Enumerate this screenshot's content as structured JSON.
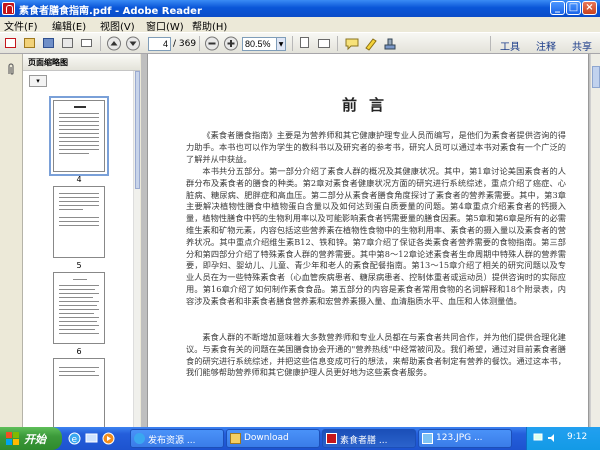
{
  "window": {
    "title": "素食者膳食指南.pdf - Adobe Reader",
    "controls": {
      "minimize": "_",
      "maximize": "□",
      "close": "×"
    }
  },
  "menu": [
    "文件(F)",
    "编辑(E)",
    "视图(V)",
    "窗口(W)",
    "帮助(H)"
  ],
  "toolbar": {
    "page_value": "4",
    "page_total": "/ 369",
    "zoom_value": "80.5%",
    "right_items": [
      "工具",
      "注释",
      "共享"
    ]
  },
  "thumbnails": {
    "header": "页面缩略图",
    "pages": [
      {
        "label": "4",
        "selected": true
      },
      {
        "label": "5",
        "selected": false
      },
      {
        "label": "6",
        "selected": false
      }
    ]
  },
  "document": {
    "title": "前言",
    "paragraphs": [
      "《素食者膳食指南》主要是为营养师和其它健康护理专业人员而编写，是他们为素食者提供咨询的得力助手。本书也可以作为学生的教科书以及研究者的参考书，研究人员可以通过本书对素食有一个广泛的了解并从中获益。",
      "本书共分五部分。第一部分介绍了素食人群的概况及其健康状况。其中，第1章讨论美国素食者的人群分布及素食者的膳食的种类。第2章对素食者健康状况方面的研究进行系统综述，重点介绍了癌症、心脏病、糖尿病、肥胖症和高血压。第二部分从素食者膳食角度探讨了素食者的营养素需要。其中，第3章主要解决植物性膳食中植物蛋白含量以及如何达到蛋白质要量的问题。第4章重点介绍素食者的钙摄入量，植物性膳食中钙的生物利用率以及可能影响素食者钙需要量的膳食因素。第5章和第6章是所有的必需维生素和矿物元素，内容包括这些营养素在植物性食物中的生物利用率、素食者的摄入量以及素食者的营养状况。其中重点介绍维生素B12、铁和锌。第7章介绍了保证各类素食者营养需要的食物指南。第三部分和第四部分介绍了特殊素食人群的营养需要。其中第8～12章论述素食者生命周期中特殊人群的营养需要，即孕妇、婴幼儿、儿童、青少年和老人的素食配餐指南。第13～15章介绍了相关的研究问题以及专业人员在为一些特殊素食者（心血管疾病患者、糖尿病患者、控制体重者或运动员）提供咨询时的实际应用。第16章介绍了如何制作素食食品。第五部分的内容是素食者常用食物的名词解释和18个附录表，内容涉及素食者和非素食者膳食营养素和宏营养素摄入量、血清脂质水平、血压和人体测量值。",
      "素食人群的不断增加意味着大多数营养师和专业人员都在与素食者共同合作，并为他们提供合理化建议。与素食有关的问题在美国膳食协会开通的\"营养热线\"中经常被问及。我们希望，通过对目前素食者膳食的研究进行系统综述，并把这些信息变成可行的想法，来帮助素食者制定有营养的餐饮。通过这本书，我们能够帮助营养师和其它健康护理人员更好地为这些素食者服务。"
    ]
  },
  "taskbar": {
    "start": "开始",
    "tasks": [
      {
        "label": "发布资源 ...",
        "active": false
      },
      {
        "label": "Download",
        "active": false
      },
      {
        "label": "素食者膳 ...",
        "active": true
      },
      {
        "label": "123.JPG ...",
        "active": false
      }
    ],
    "clock": "9:12"
  },
  "colors": {
    "titlebar": "#0a56d8",
    "taskbar": "#245edb",
    "start_button": "#3c9a3a",
    "adobe_red": "#c4161c"
  }
}
